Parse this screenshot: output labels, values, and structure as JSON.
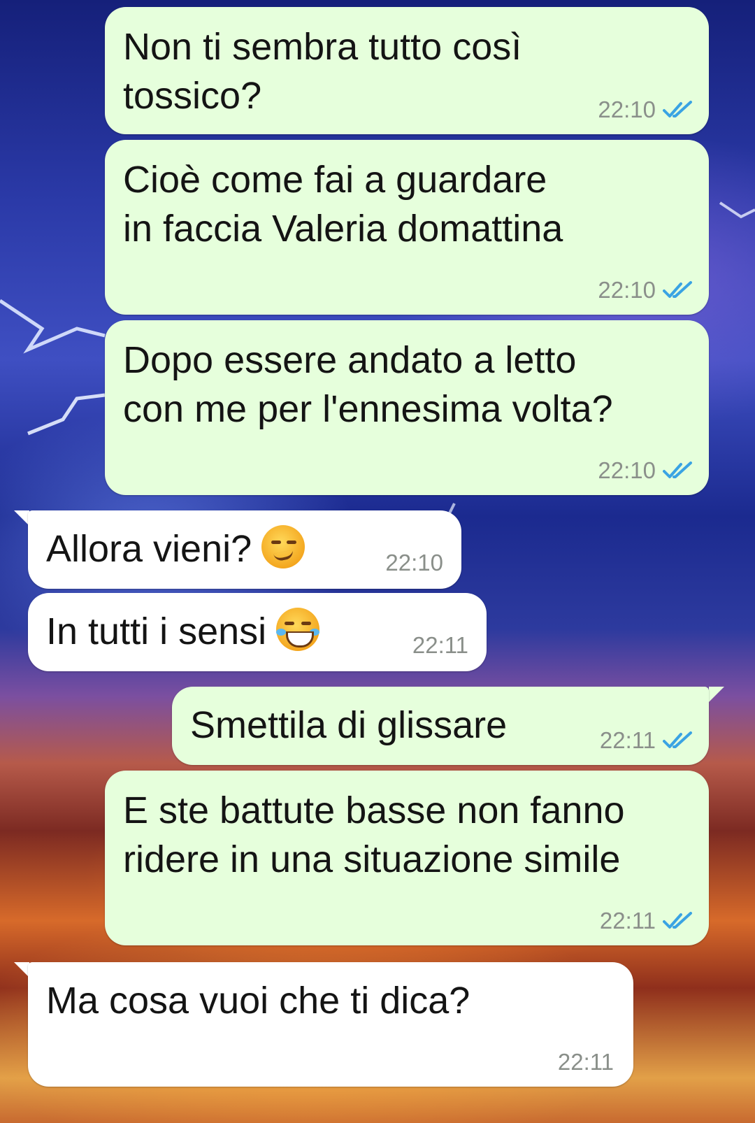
{
  "messages": [
    {
      "direction": "out",
      "lines": "Non ti sembra tutto così\ntossico?",
      "time": "22:10",
      "read": true
    },
    {
      "direction": "out",
      "lines": "Cioè come fai a guardare\nin faccia Valeria domattina",
      "time": "22:10",
      "read": true
    },
    {
      "direction": "out",
      "lines": "Dopo essere andato a letto\ncon me per l'ennesima volta?",
      "time": "22:10",
      "read": true
    },
    {
      "direction": "in",
      "lines": "Allora vieni?",
      "emoji": "smirking-face",
      "time": "22:10"
    },
    {
      "direction": "in",
      "lines": "In tutti i sensi",
      "emoji": "face-with-tears-of-joy",
      "time": "22:11"
    },
    {
      "direction": "out",
      "lines": "Smettila di glissare",
      "time": "22:11",
      "read": true
    },
    {
      "direction": "out",
      "lines": "E ste battute basse non fanno\nridere in una situazione simile",
      "time": "22:11",
      "read": true
    },
    {
      "direction": "in",
      "lines": "Ma cosa vuoi che ti dica?",
      "time": "22:11"
    }
  ],
  "colors": {
    "outgoing_bubble": "#e6ffdc",
    "incoming_bubble": "#ffffff",
    "read_tick": "#3aa3e3",
    "timestamp": "#8a8f8a"
  }
}
